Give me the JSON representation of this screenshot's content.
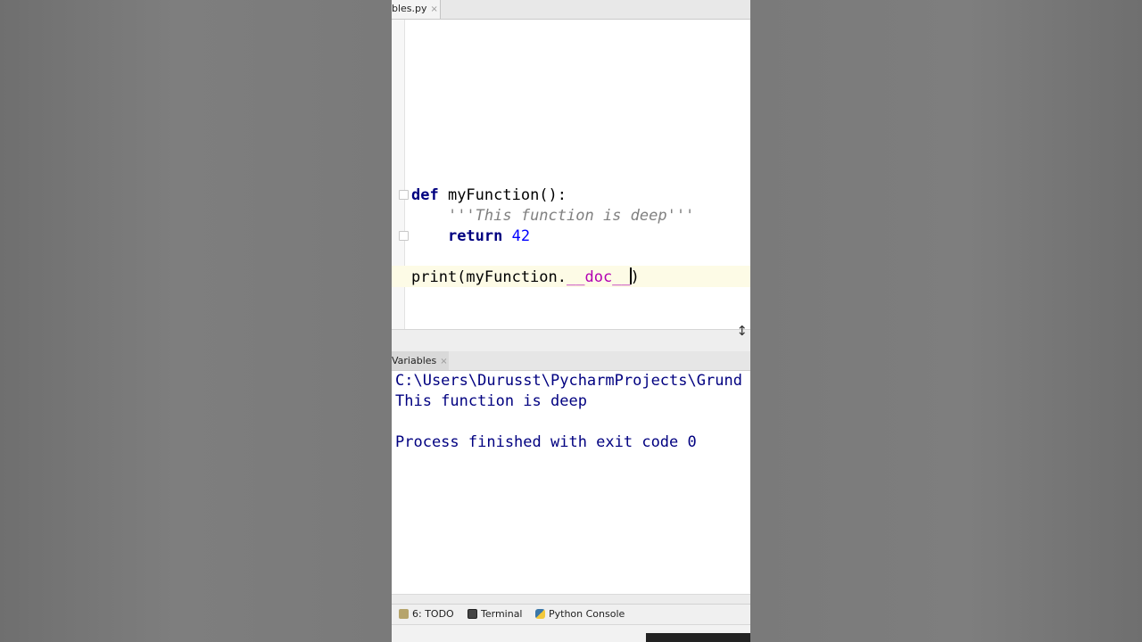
{
  "editor": {
    "tab_label": "bles.py",
    "tab_close": "×",
    "lines": {
      "def_kw": "def",
      "def_rest": " myFunction():",
      "docstring_indent": "    ",
      "docstring": "'''This function is deep'''",
      "return_indent": "    ",
      "return_kw": "return",
      "return_value": " 42",
      "print_prefix": "print(myFunction.",
      "print_attr_a": "__doc_",
      "print_attr_b": "_",
      "print_suffix": ")"
    }
  },
  "run": {
    "tab_label": "Variables",
    "tab_close": "×",
    "output": {
      "path": "C:\\Users\\Durusst\\PycharmProjects\\Grund",
      "result": "This function is deep",
      "exit": "Process finished with exit code 0"
    }
  },
  "bottom_tabs": [
    {
      "label": "6: TODO",
      "icon": "todo-icon"
    },
    {
      "label": "Terminal",
      "icon": "terminal-icon"
    },
    {
      "label": "Python Console",
      "icon": "python-icon"
    }
  ],
  "colors": {
    "keyword": "#000080",
    "comment": "#808080",
    "number": "#0000ff",
    "magic": "#b200b2",
    "current_line": "#fdfbe6"
  }
}
